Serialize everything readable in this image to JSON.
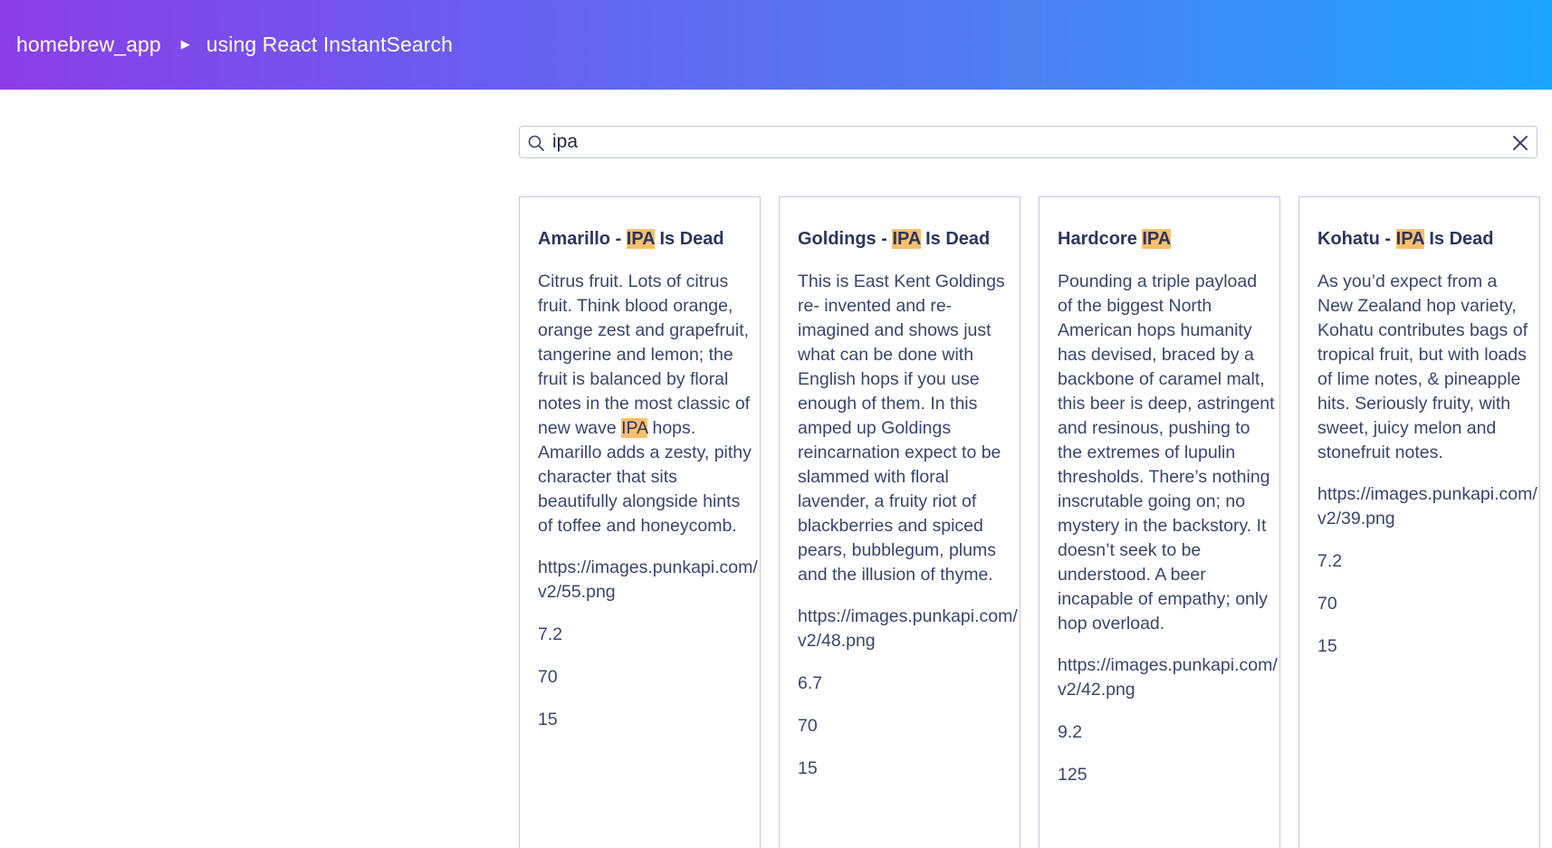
{
  "header": {
    "crumb_app": "homebrew_app",
    "crumb_page": "using React InstantSearch"
  },
  "search": {
    "value": "ipa",
    "icon": "search-icon",
    "clear_icon": "close-icon"
  },
  "colors": {
    "highlight": "#f9bf6c",
    "gradient_start": "#8b3ee6",
    "gradient_end": "#1aa6fb"
  },
  "hits": [
    {
      "title_pre": "Amarillo - ",
      "title_hl": "IPA",
      "title_post": " Is Dead",
      "desc_pre": "Citrus fruit. Lots of citrus fruit. Think blood orange, orange zest and grapefruit, tangerine and lemon; the fruit is balanced by floral notes in the most classic of new wave ",
      "desc_hl": "IPA",
      "desc_post": " hops. Amarillo adds a zesty, pithy character that sits beautifully alongside hints of toffee and honeycomb.",
      "image_url": "https://images.punkapi.com/v2/55.png",
      "abv": "7.2",
      "ibu": "70",
      "ebc": "15"
    },
    {
      "title_pre": "Goldings - ",
      "title_hl": "IPA",
      "title_post": " Is Dead",
      "desc_pre": "This is East Kent Goldings re- invented and re-imagined and shows just what can be done with English hops if you use enough of them. In this amped up Goldings reincarnation expect to be slammed with floral lavender, a fruity riot of blackberries and spiced pears, bubblegum, plums and the illusion of thyme.",
      "desc_hl": "",
      "desc_post": "",
      "image_url": "https://images.punkapi.com/v2/48.png",
      "abv": "6.7",
      "ibu": "70",
      "ebc": "15"
    },
    {
      "title_pre": "Hardcore ",
      "title_hl": "IPA",
      "title_post": "",
      "desc_pre": "Pounding a triple payload of the biggest North American hops humanity has devised, braced by a backbone of caramel malt, this beer is deep, astringent and resinous, pushing to the extremes of lupulin thresholds. There’s nothing inscrutable going on; no mystery in the backstory. It doesn’t seek to be understood. A beer incapable of empathy; only hop overload.",
      "desc_hl": "",
      "desc_post": "",
      "image_url": "https://images.punkapi.com/v2/42.png",
      "abv": "9.2",
      "ibu": "125",
      "ebc": ""
    },
    {
      "title_pre": "Kohatu - ",
      "title_hl": "IPA",
      "title_post": " Is Dead",
      "desc_pre": "As you’d expect from a New Zealand hop variety, Kohatu contributes bags of tropical fruit, but with loads of lime notes, & pineapple hits. Seriously fruity, with sweet, juicy melon and stonefruit notes.",
      "desc_hl": "",
      "desc_post": "",
      "image_url": "https://images.punkapi.com/v2/39.png",
      "abv": "7.2",
      "ibu": "70",
      "ebc": "15"
    }
  ]
}
